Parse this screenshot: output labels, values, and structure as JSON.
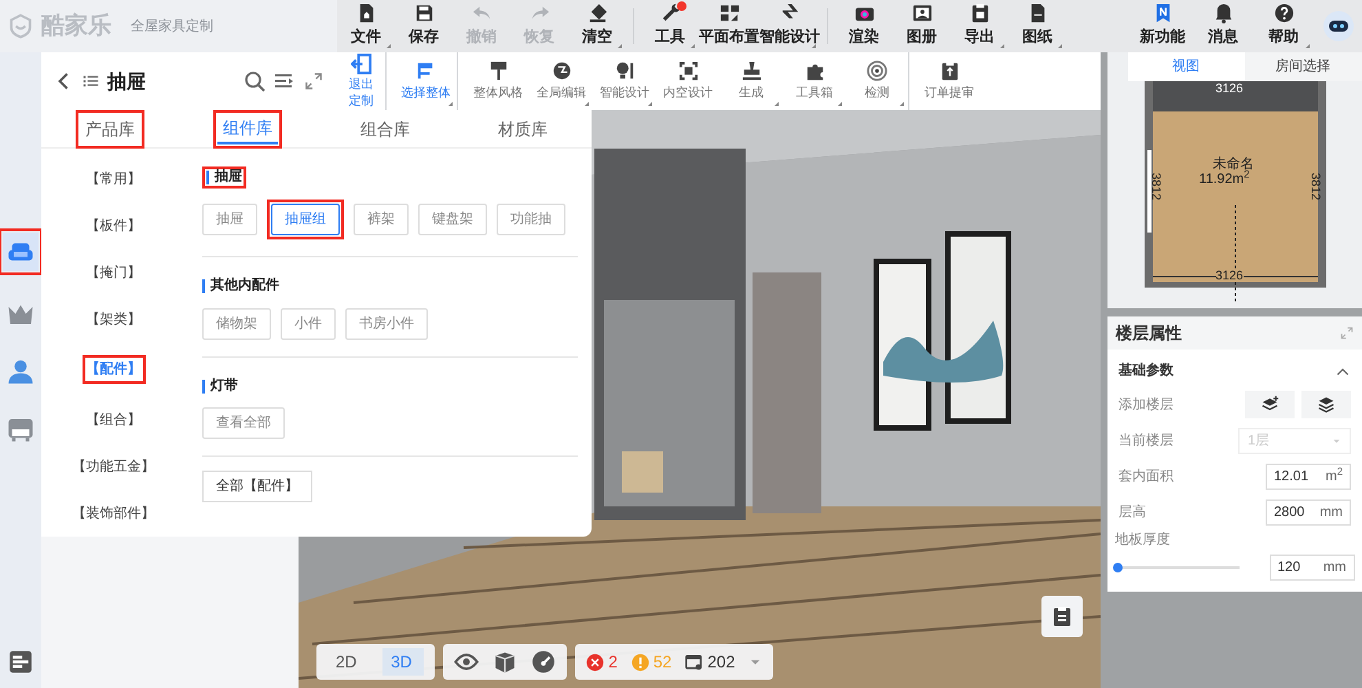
{
  "app": {
    "logo": "酷家乐",
    "subtitle": "全屋家具定制"
  },
  "top_toolbar": [
    {
      "label": "文件",
      "dropdown": true,
      "disabled": false,
      "notify": false,
      "group_end": false
    },
    {
      "label": "保存",
      "dropdown": false,
      "disabled": false,
      "notify": false,
      "group_end": false
    },
    {
      "label": "撤销",
      "dropdown": false,
      "disabled": true,
      "notify": false,
      "group_end": false
    },
    {
      "label": "恢复",
      "dropdown": false,
      "disabled": true,
      "notify": false,
      "group_end": false
    },
    {
      "label": "清空",
      "dropdown": true,
      "disabled": false,
      "notify": false,
      "group_end": true
    },
    {
      "label": "工具",
      "dropdown": true,
      "disabled": false,
      "notify": true,
      "group_end": false
    },
    {
      "label": "平面布置",
      "dropdown": false,
      "disabled": false,
      "notify": false,
      "group_end": false
    },
    {
      "label": "智能设计",
      "dropdown": true,
      "disabled": false,
      "notify": false,
      "group_end": true
    },
    {
      "label": "渲染",
      "dropdown": false,
      "disabled": false,
      "notify": false,
      "group_end": false
    },
    {
      "label": "图册",
      "dropdown": false,
      "disabled": false,
      "notify": false,
      "group_end": false
    },
    {
      "label": "导出",
      "dropdown": true,
      "disabled": false,
      "notify": false,
      "group_end": false
    },
    {
      "label": "图纸",
      "dropdown": true,
      "disabled": false,
      "notify": false,
      "group_end": false
    }
  ],
  "top_right": [
    {
      "label": "新功能",
      "dropdown": false
    },
    {
      "label": "消息",
      "dropdown": false
    },
    {
      "label": "帮助",
      "dropdown": true
    }
  ],
  "left_rail": [
    {
      "selected": true,
      "highlighted": true
    },
    {
      "selected": false,
      "highlighted": false
    },
    {
      "selected": false,
      "highlighted": false
    },
    {
      "selected": false,
      "highlighted": false
    }
  ],
  "sub_toolbar": [
    {
      "label": "退出定制",
      "selected": true,
      "dropdown": false,
      "group_end": true
    },
    {
      "label": "选择整体",
      "selected": true,
      "dropdown": true,
      "group_end": true
    },
    {
      "label": "整体风格",
      "selected": false,
      "dropdown": false,
      "group_end": false
    },
    {
      "label": "全局编辑",
      "selected": false,
      "dropdown": true,
      "group_end": false
    },
    {
      "label": "智能设计",
      "selected": false,
      "dropdown": true,
      "group_end": false
    },
    {
      "label": "内空设计",
      "selected": false,
      "dropdown": false,
      "group_end": false
    },
    {
      "label": "生成",
      "selected": false,
      "dropdown": true,
      "group_end": false
    },
    {
      "label": "工具箱",
      "selected": false,
      "dropdown": true,
      "group_end": false
    },
    {
      "label": "检测",
      "selected": false,
      "dropdown": true,
      "group_end": true
    },
    {
      "label": "订单提审",
      "selected": false,
      "dropdown": false,
      "group_end": false
    }
  ],
  "library_panel": {
    "title": "抽屉",
    "tabs": [
      {
        "label": "产品库",
        "selected": false,
        "highlighted": true
      },
      {
        "label": "组件库",
        "selected": true,
        "highlighted": true
      },
      {
        "label": "组合库",
        "selected": false,
        "highlighted": false
      },
      {
        "label": "材质库",
        "selected": false,
        "highlighted": false
      }
    ],
    "categories": [
      {
        "label": "【常用】",
        "selected": false,
        "highlighted": false
      },
      {
        "label": "【板件】",
        "selected": false,
        "highlighted": false
      },
      {
        "label": "【掩门】",
        "selected": false,
        "highlighted": false
      },
      {
        "label": "【架类】",
        "selected": false,
        "highlighted": false
      },
      {
        "label": "【配件】",
        "selected": true,
        "highlighted": true
      },
      {
        "label": "【组合】",
        "selected": false,
        "highlighted": false
      },
      {
        "label": "【功能五金】",
        "selected": false,
        "highlighted": false
      },
      {
        "label": "【装饰部件】",
        "selected": false,
        "highlighted": false
      }
    ],
    "sections": [
      {
        "title": "抽屉",
        "highlighted": true,
        "items": [
          {
            "label": "抽屉",
            "selected": false,
            "highlighted": false
          },
          {
            "label": "抽屉组",
            "selected": true,
            "highlighted": true
          },
          {
            "label": "裤架",
            "selected": false,
            "highlighted": false
          },
          {
            "label": "键盘架",
            "selected": false,
            "highlighted": false
          },
          {
            "label": "功能抽",
            "selected": false,
            "highlighted": false
          }
        ]
      },
      {
        "title": "其他内配件",
        "highlighted": false,
        "items": [
          {
            "label": "储物架",
            "selected": false,
            "highlighted": false
          },
          {
            "label": "小件",
            "selected": false,
            "highlighted": false
          },
          {
            "label": "书房小件",
            "selected": false,
            "highlighted": false
          }
        ]
      },
      {
        "title": "灯带",
        "highlighted": false,
        "items": [
          {
            "label": "查看全部",
            "selected": false,
            "highlighted": false
          }
        ]
      }
    ],
    "all_button": "全部【配件】"
  },
  "view_bar": {
    "modes": [
      {
        "label": "2D",
        "selected": false
      },
      {
        "label": "3D",
        "selected": true
      }
    ],
    "errors": "2",
    "warnings": "52",
    "count": "202"
  },
  "right_panel": {
    "tabs": [
      {
        "label": "视图",
        "selected": true
      },
      {
        "label": "房间选择",
        "selected": false
      }
    ],
    "plan": {
      "top_dim": "3126",
      "room_name": "未命名",
      "area": "11.92m$^{2}$",
      "left_dim": "3812",
      "right_dim": "3812",
      "bottom_dim": "3126"
    },
    "floor_props": {
      "title": "楼层属性",
      "section": "基础参数",
      "expanded": true,
      "rows": [
        {
          "kind": "buttons",
          "label": "添加楼层"
        },
        {
          "kind": "select",
          "label": "当前楼层",
          "value": "1层",
          "disabled": true
        },
        {
          "kind": "input",
          "label": "套内面积",
          "value": "12.01",
          "unit": "m$^{2}$"
        },
        {
          "kind": "input",
          "label": "层高",
          "value": "2800",
          "unit": "mm"
        },
        {
          "kind": "slider",
          "label": "地板厚度",
          "level": 0.02,
          "value": "120",
          "unit": "mm"
        }
      ]
    }
  }
}
